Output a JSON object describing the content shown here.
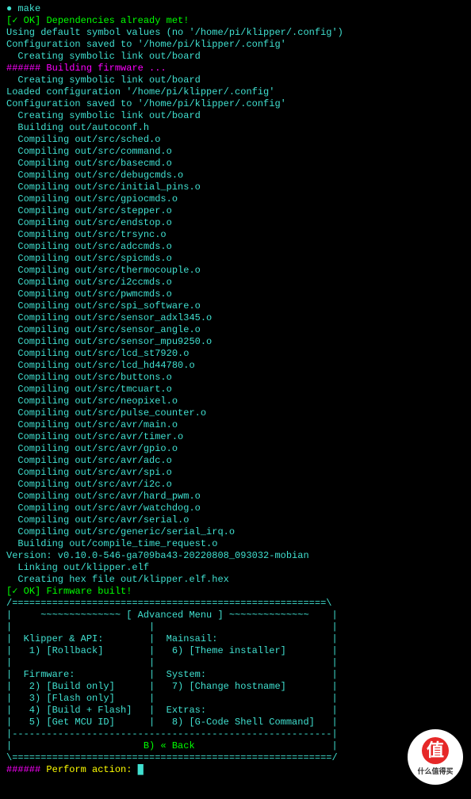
{
  "prompt": {
    "bullet": "●",
    "cmd": "make"
  },
  "deps_ok": {
    "prefix": "[✓ OK]",
    "msg": "Dependencies already met!"
  },
  "pre_lines": [
    "Using default symbol values (no '/home/pi/klipper/.config')",
    "Configuration saved to '/home/pi/klipper/.config'",
    "  Creating symbolic link out/board",
    ""
  ],
  "build_header": {
    "hashes": "######",
    "msg": "Building firmware ..."
  },
  "build_lines": [
    "  Creating symbolic link out/board",
    "Loaded configuration '/home/pi/klipper/.config'",
    "Configuration saved to '/home/pi/klipper/.config'",
    "  Creating symbolic link out/board",
    "  Building out/autoconf.h",
    "  Compiling out/src/sched.o",
    "  Compiling out/src/command.o",
    "  Compiling out/src/basecmd.o",
    "  Compiling out/src/debugcmds.o",
    "  Compiling out/src/initial_pins.o",
    "  Compiling out/src/gpiocmds.o",
    "  Compiling out/src/stepper.o",
    "  Compiling out/src/endstop.o",
    "  Compiling out/src/trsync.o",
    "  Compiling out/src/adccmds.o",
    "  Compiling out/src/spicmds.o",
    "  Compiling out/src/thermocouple.o",
    "  Compiling out/src/i2ccmds.o",
    "  Compiling out/src/pwmcmds.o",
    "  Compiling out/src/spi_software.o",
    "  Compiling out/src/sensor_adxl345.o",
    "  Compiling out/src/sensor_angle.o",
    "  Compiling out/src/sensor_mpu9250.o",
    "  Compiling out/src/lcd_st7920.o",
    "  Compiling out/src/lcd_hd44780.o",
    "  Compiling out/src/buttons.o",
    "  Compiling out/src/tmcuart.o",
    "  Compiling out/src/neopixel.o",
    "  Compiling out/src/pulse_counter.o",
    "  Compiling out/src/avr/main.o",
    "  Compiling out/src/avr/timer.o",
    "  Compiling out/src/avr/gpio.o",
    "  Compiling out/src/avr/adc.o",
    "  Compiling out/src/avr/spi.o",
    "  Compiling out/src/avr/i2c.o",
    "  Compiling out/src/avr/hard_pwm.o",
    "  Compiling out/src/avr/watchdog.o",
    "  Compiling out/src/avr/serial.o",
    "  Compiling out/src/generic/serial_irq.o",
    "  Building out/compile_time_request.o",
    "Version: v0.10.0-546-ga709ba43-20220808_093032-mobian",
    "  Linking out/klipper.elf",
    "  Creating hex file out/klipper.elf.hex"
  ],
  "fw_ok": {
    "prefix": "[✓ OK]",
    "msg": "Firmware built!"
  },
  "menu": {
    "top": "/=======================================================\\",
    "title": "|     ~~~~~~~~~~~~~~ [ Advanced Menu ] ~~~~~~~~~~~~~~    |",
    "blank": "|                        |                               |",
    "row1": "|  Klipper & API:        |  Mainsail:                    |",
    "row2": "|   1) [Rollback]        |   6) [Theme installer]        |",
    "row3": "|  Firmware:             |  System:                      |",
    "row4": "|   2) [Build only]      |   7) [Change hostname]        |",
    "row5": "|   3) [Flash only]      |                               |",
    "row6": "|   4) [Build + Flash]   |  Extras:                      |",
    "row7": "|   5) [Get MCU ID]      |   8) [G-Code Shell Command]   |",
    "sep": "|--------------------------------------------------------|",
    "back_l": "|                       ",
    "back": "B) « Back",
    "back_r": "                        |",
    "bot": "\\========================================================/"
  },
  "action": {
    "hashes": "######",
    "label": "Perform action:",
    "cursor": "█"
  },
  "watermark": {
    "char": "值",
    "text": "什么值得买"
  }
}
